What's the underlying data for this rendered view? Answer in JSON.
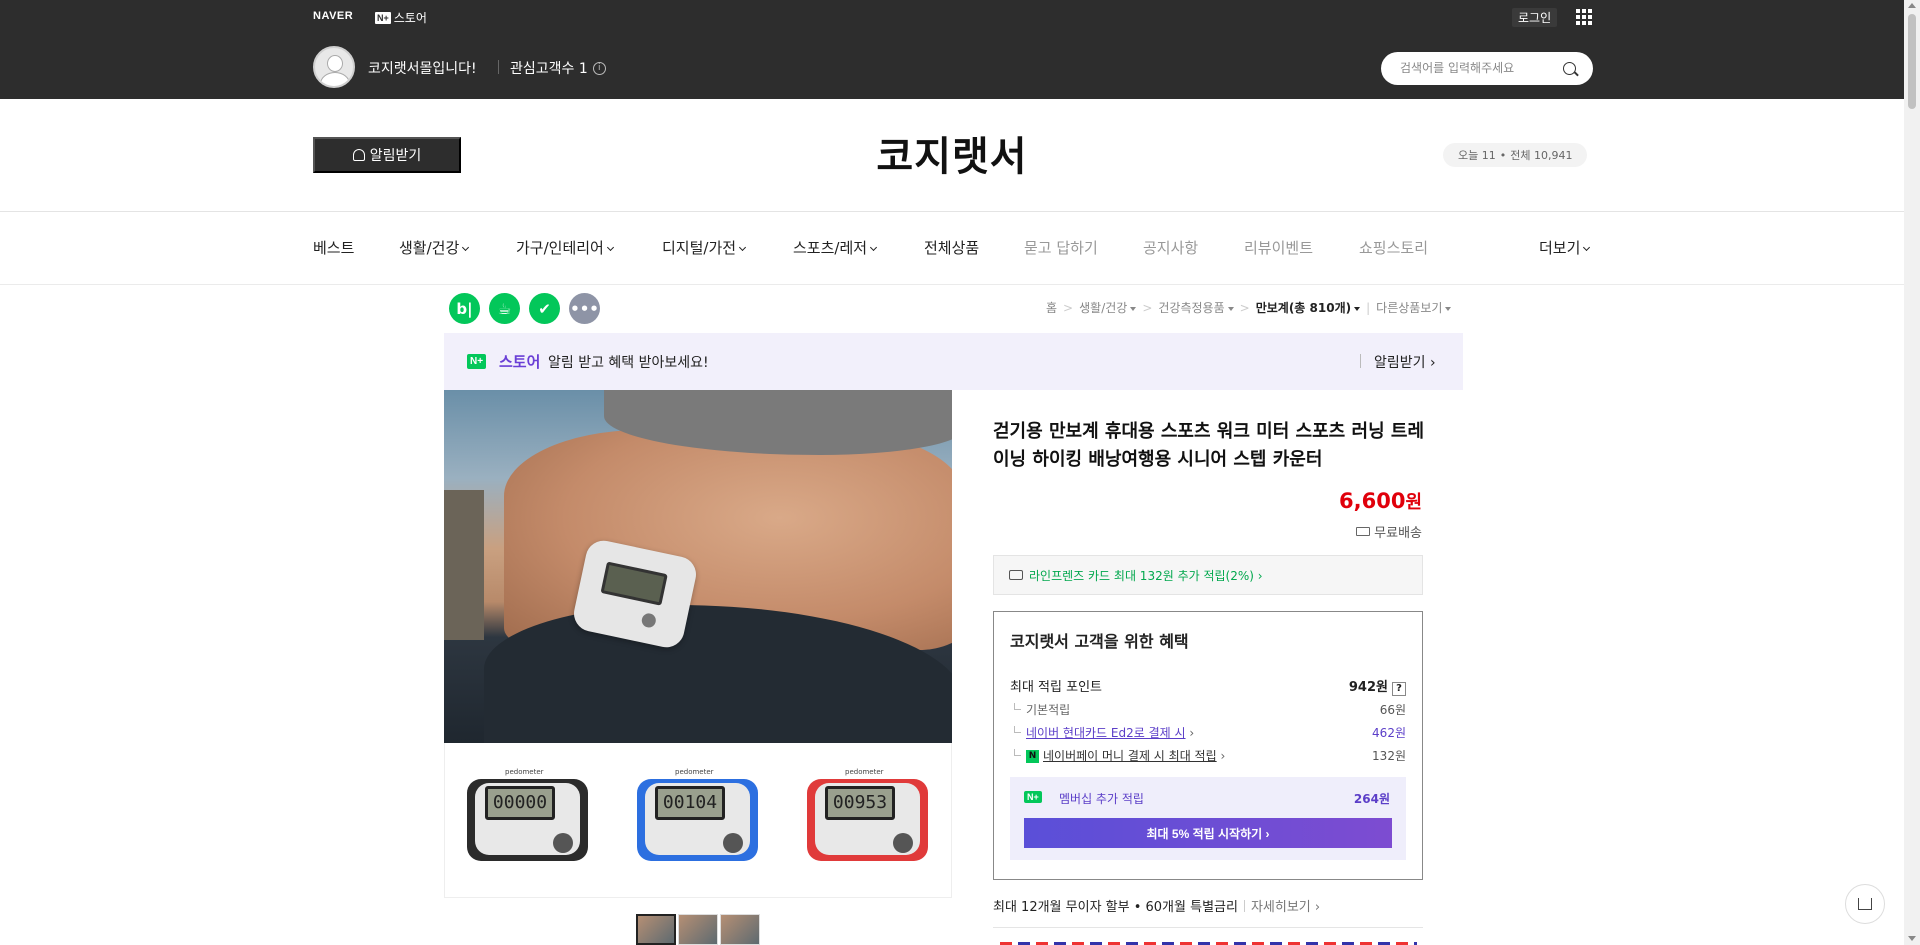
{
  "topbar": {
    "naver_logo": "NAVER",
    "nstore_badge": "N+",
    "nstore_label": "스토어",
    "login_label": "로그인",
    "store_name": "코지랫서몰입니다!",
    "fav_label": "관심고객수 1",
    "search_placeholder": "검색어를 입력해주세요"
  },
  "header": {
    "alarm_label": "알림받기",
    "site_title": "코지랫서",
    "visit_today": "오늘 11",
    "visit_sep": "•",
    "visit_total": "전체 10,941"
  },
  "nav": {
    "items": [
      {
        "label": "베스트"
      },
      {
        "label": "생활/건강"
      },
      {
        "label": "가구/인테리어"
      },
      {
        "label": "디지털/가전"
      },
      {
        "label": "스포츠/레저"
      },
      {
        "label": "전체상품"
      },
      {
        "label": "묻고 답하기"
      },
      {
        "label": "공지사항"
      },
      {
        "label": "리뷰이벤트"
      },
      {
        "label": "쇼핑스토리"
      },
      {
        "label": "더보기"
      }
    ]
  },
  "share": {
    "icons": [
      {
        "name": "blog-share-icon",
        "glyph": "b|",
        "color": "#03c75a"
      },
      {
        "name": "cafe-share-icon",
        "glyph": "☕",
        "color": "#03c75a"
      },
      {
        "name": "bookmark-share-icon",
        "glyph": "✔",
        "color": "#03c75a"
      },
      {
        "name": "more-share-icon",
        "glyph": "•••",
        "color": "#8e94a6"
      }
    ]
  },
  "breadcrumb": {
    "home": "홈",
    "cat1": "생활/건강",
    "cat2": "건강측정용품",
    "cat3": "만보계(총 810개)",
    "other": "다른상품보기"
  },
  "promo": {
    "badge": "N+",
    "store_word": "스토어",
    "text": "알림 받고 혜택 받아보세요!",
    "link": "알림받기 ›"
  },
  "gallery": {
    "variants": [
      {
        "label": "pedometer",
        "screen": "00000",
        "color": "#2b2b2b"
      },
      {
        "label": "pedometer",
        "screen": "00104",
        "color": "#2c6fe0"
      },
      {
        "label": "pedometer",
        "screen": "00953",
        "color": "#e03a3a"
      }
    ]
  },
  "product": {
    "title": "걷기용 만보계 휴대용 스포츠 워크 미터 스포츠 러닝 트레이닝 하이킹 배낭여행용 시니어 스텝 카운터",
    "price": "6,600",
    "price_unit": "원",
    "shipping": "무료배송",
    "card_offer": "라인프렌즈 카드 최대 132원 추가 적립(2%) ›"
  },
  "benefits": {
    "title": "코지랫서 고객을 위한 혜택",
    "max_points_label": "최대 적립 포인트",
    "max_points_value": "942원",
    "help": "?",
    "basic_label": "기본적립",
    "basic_value": "66원",
    "card_label": "네이버 현대카드 Ed2로 결제 시",
    "card_value": "462원",
    "pay_label": "네이버페이 머니 결제 시 최대 적립",
    "pay_value": "132원",
    "member_badge": "N+",
    "member_label": "멤버십 추가 적립",
    "member_value": "264원",
    "member_btn": "최대 5% 적립 시작하기 ›"
  },
  "installment": {
    "text": "최대 12개월 무이자 할부 • 60개월 특별금리",
    "more": "자세히보기 ›"
  }
}
